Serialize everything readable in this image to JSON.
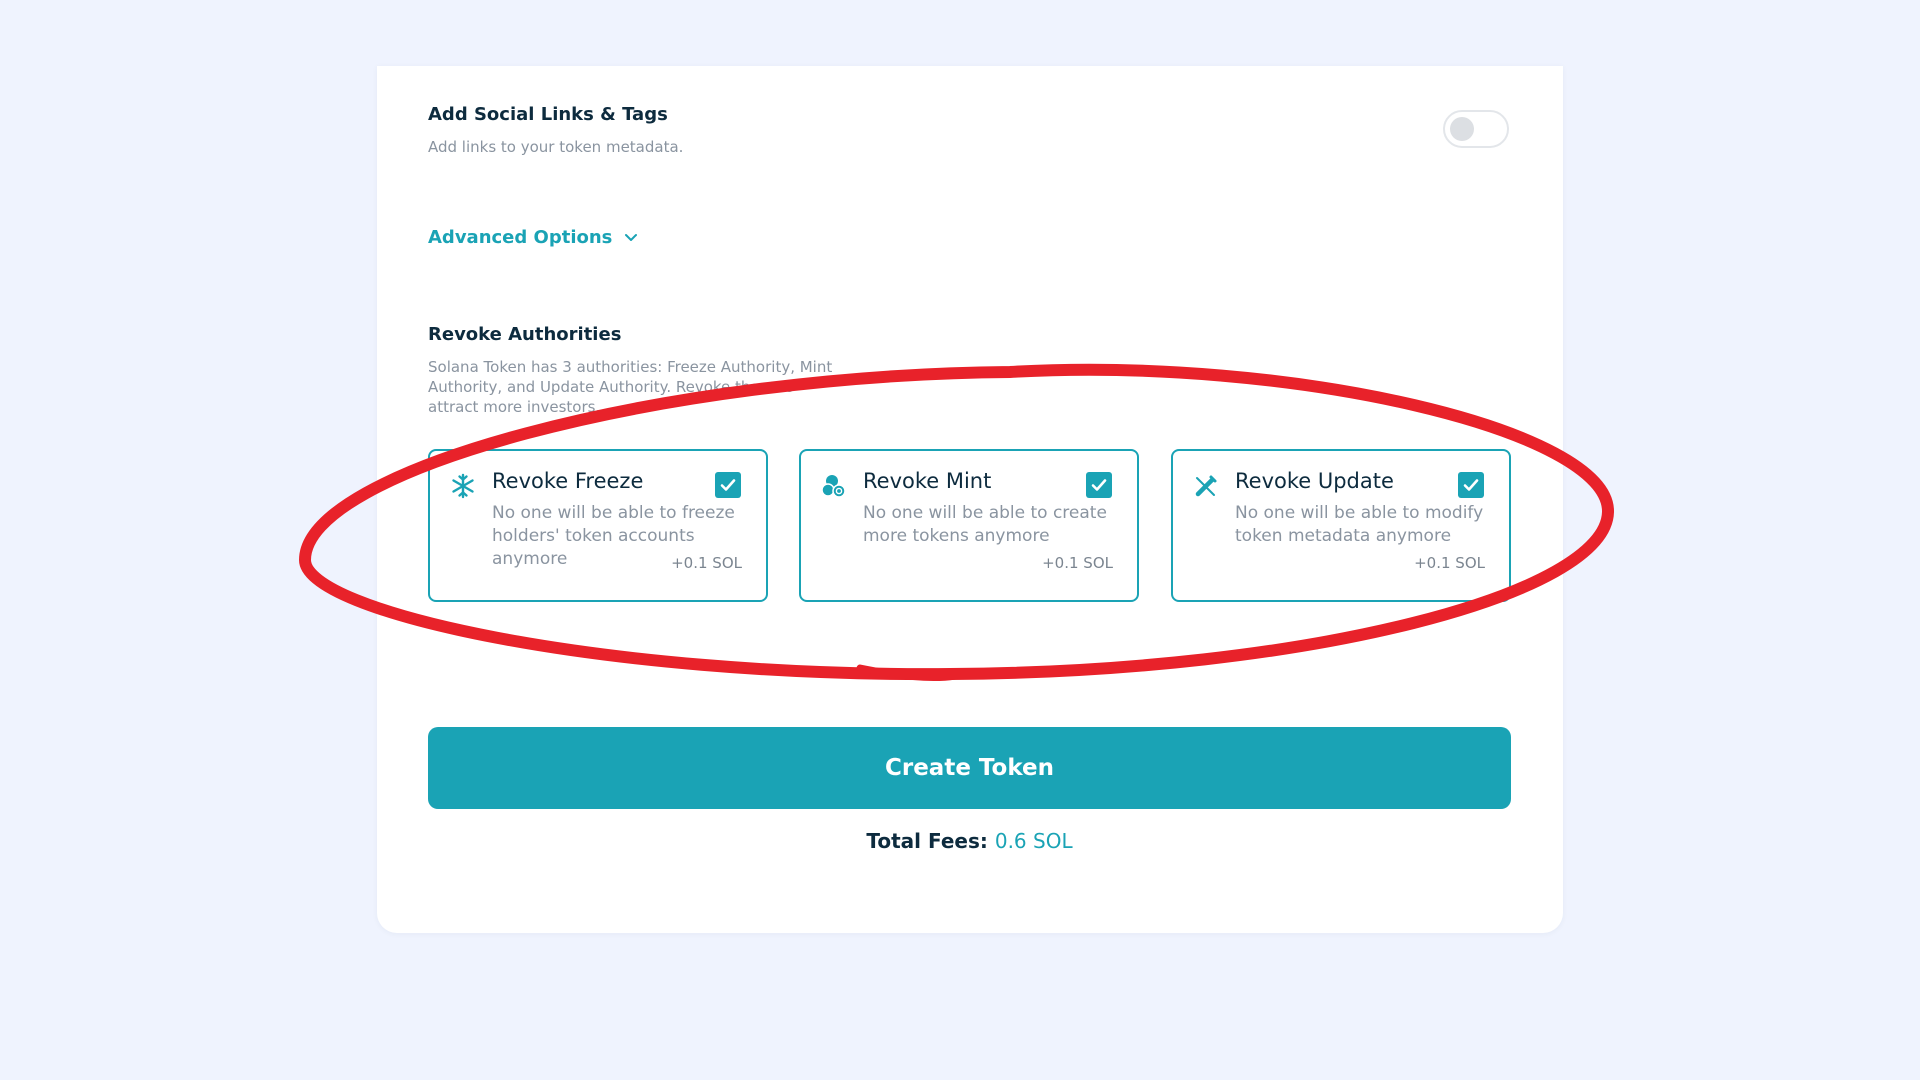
{
  "social": {
    "title": "Add Social Links & Tags",
    "description": "Add links to your token metadata.",
    "toggle_enabled": false
  },
  "advanced": {
    "label": "Advanced Options",
    "icon": "chevron-down-icon"
  },
  "revoke": {
    "title": "Revoke Authorities",
    "description": "Solana Token has 3 authorities: Freeze Authority, Mint Authority, and Update Authority. Revoke them to attract more investors.",
    "options": [
      {
        "title": "Revoke Freeze",
        "description": "No one will be able to freeze holders' token accounts anymore",
        "fee": "+0.1 SOL",
        "icon": "snowflake-icon",
        "checked": true
      },
      {
        "title": "Revoke Mint",
        "description": "No one will be able to create more tokens anymore",
        "fee": "+0.1 SOL",
        "icon": "coins-icon",
        "checked": true
      },
      {
        "title": "Revoke Update",
        "description": "No one will be able to modify token metadata anymore",
        "fee": "+0.1 SOL",
        "icon": "pen-icon",
        "checked": true
      }
    ]
  },
  "create_button": {
    "label": "Create Token"
  },
  "fees": {
    "label": "Total Fees:",
    "value": "0.6 SOL"
  },
  "colors": {
    "accent": "#1aa3b5",
    "heading": "#0d2b3e",
    "muted": "#8a94a0",
    "background": "#eff3fe",
    "annotation": "#e8222a"
  }
}
